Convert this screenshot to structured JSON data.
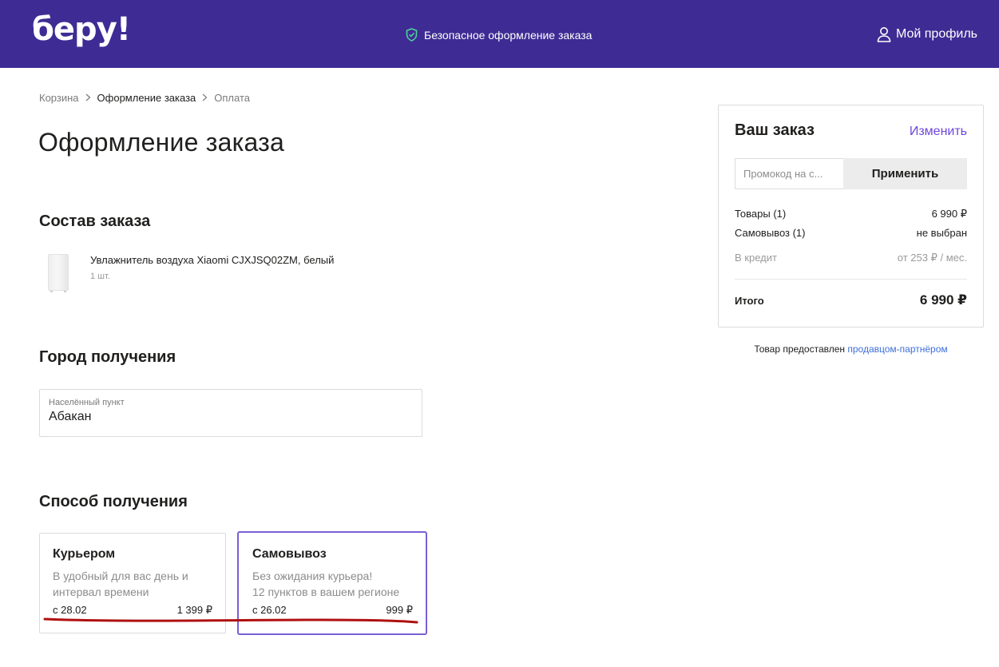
{
  "header": {
    "logo": "беру!",
    "secure_text": "Безопасное оформление заказа",
    "profile_label": "Мой профиль"
  },
  "breadcrumb": {
    "items": [
      "Корзина",
      "Оформление заказа",
      "Оплата"
    ]
  },
  "page_title": "Оформление заказа",
  "order_contents": {
    "title": "Состав заказа",
    "product_name": "Увлажнитель воздуха Xiaomi CJXJSQ02ZM, белый",
    "product_qty": "1 шт."
  },
  "city": {
    "title": "Город получения",
    "label": "Населённый пункт",
    "value": "Абакан"
  },
  "delivery": {
    "title": "Способ получения",
    "courier": {
      "title": "Курьером",
      "desc": "В удобный для вас день и интервал времени",
      "date": "с 28.02",
      "price": "1 399 ₽"
    },
    "pickup": {
      "title": "Самовывоз",
      "desc_line1": "Без ожидания курьера!",
      "desc_line2": "12 пунктов в вашем регионе",
      "date": "с 26.02",
      "price": "999 ₽"
    }
  },
  "order_card": {
    "title": "Ваш заказ",
    "change": "Изменить",
    "promo_placeholder": "Промокод на с...",
    "apply": "Применить",
    "goods_label": "Товары (1)",
    "goods_value": "6 990 ₽",
    "pickup_label": "Самовывоз (1)",
    "pickup_value": "не выбран",
    "credit_label": "В кредит",
    "credit_value": "от 253 ₽ / мес.",
    "total_label": "Итого",
    "total_value": "6 990 ₽"
  },
  "partner": {
    "text": "Товар предоставлен ",
    "link": "продавцом-партнёром"
  },
  "colors": {
    "header_bg": "#3e2c94",
    "accent": "#6f47db",
    "selected_border": "#7b5ed6",
    "annotation_red": "#b01010"
  }
}
